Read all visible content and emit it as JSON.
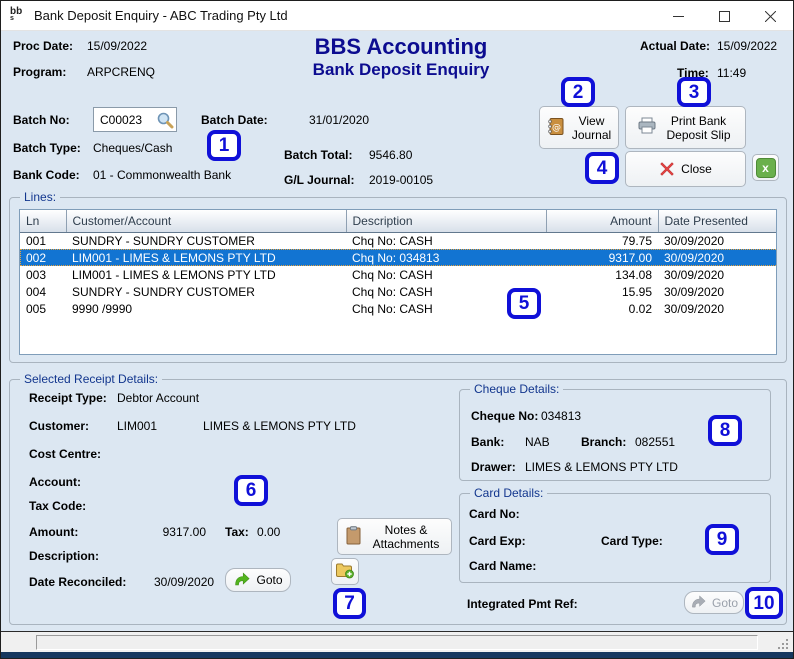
{
  "window": {
    "icon_text": "bb",
    "icon_sub": "s",
    "title": "Bank Deposit Enquiry - ABC Trading Pty Ltd"
  },
  "header": {
    "proc_date_label": "Proc Date:",
    "proc_date": "15/09/2022",
    "program_label": "Program:",
    "program": "ARPCRENQ",
    "app_title": "BBS Accounting",
    "screen_title": "Bank Deposit Enquiry",
    "actual_date_label": "Actual Date:",
    "actual_date": "15/09/2022",
    "time_label": "Time:",
    "time": "11:49"
  },
  "batch": {
    "batch_no_label": "Batch No:",
    "batch_no": "C00023",
    "batch_date_label": "Batch Date:",
    "batch_date": "31/01/2020",
    "batch_type_label": "Batch Type:",
    "batch_type": "Cheques/Cash",
    "batch_total_label": "Batch Total:",
    "batch_total": "9546.80",
    "bank_code_label": "Bank Code:",
    "bank_code": "01 - Commonwealth Bank",
    "gl_journal_label": "G/L Journal:",
    "gl_journal": "2019-00105"
  },
  "actions": {
    "view_journal": "View Journal",
    "print_deposit_slip": "Print Bank Deposit Slip",
    "close": "Close"
  },
  "lines": {
    "label": "Lines:",
    "columns": [
      "Ln",
      "Customer/Account",
      "Description",
      "Amount",
      "Date Presented"
    ],
    "rows": [
      {
        "ln": "001",
        "customer": "SUNDRY - SUNDRY CUSTOMER",
        "description": "Chq No: CASH",
        "amount": "79.75",
        "date_presented": "30/09/2020",
        "selected": false
      },
      {
        "ln": "002",
        "customer": "LIM001 - LIMES & LEMONS PTY LTD",
        "description": "Chq No: 034813",
        "amount": "9317.00",
        "date_presented": "30/09/2020",
        "selected": true
      },
      {
        "ln": "003",
        "customer": "LIM001 - LIMES & LEMONS PTY LTD",
        "description": "Chq No: CASH",
        "amount": "134.08",
        "date_presented": "30/09/2020",
        "selected": false
      },
      {
        "ln": "004",
        "customer": "SUNDRY - SUNDRY CUSTOMER",
        "description": "Chq No: CASH",
        "amount": "15.95",
        "date_presented": "30/09/2020",
        "selected": false
      },
      {
        "ln": "005",
        "customer": "9990 /9990",
        "description": "Chq No: CASH",
        "amount": "0.02",
        "date_presented": "30/09/2020",
        "selected": false
      }
    ]
  },
  "receipt": {
    "label": "Selected Receipt Details:",
    "receipt_type_label": "Receipt Type:",
    "receipt_type": "Debtor Account",
    "customer_label": "Customer:",
    "customer_code": "LIM001",
    "customer_name": "LIMES & LEMONS PTY LTD",
    "cost_centre_label": "Cost Centre:",
    "cost_centre": "",
    "account_label": "Account:",
    "account": "",
    "tax_code_label": "Tax Code:",
    "tax_code": "",
    "amount_label": "Amount:",
    "amount": "9317.00",
    "tax_label": "Tax:",
    "tax": "0.00",
    "description_label": "Description:",
    "description": "",
    "date_reconciled_label": "Date Reconciled:",
    "date_reconciled": "30/09/2020",
    "goto_label": "Goto",
    "notes_button": "Notes & Attachments"
  },
  "cheque": {
    "label": "Cheque Details:",
    "cheque_no_label": "Cheque No:",
    "cheque_no": "034813",
    "bank_label": "Bank:",
    "bank": "NAB",
    "branch_label": "Branch:",
    "branch": "082551",
    "drawer_label": "Drawer:",
    "drawer": "LIMES & LEMONS PTY LTD"
  },
  "card": {
    "label": "Card Details:",
    "card_no_label": "Card No:",
    "card_no": "",
    "card_exp_label": "Card Exp:",
    "card_exp": "",
    "card_type_label": "Card Type:",
    "card_type": "",
    "card_name_label": "Card Name:",
    "card_name": ""
  },
  "integrated": {
    "label": "Integrated Pmt Ref:",
    "value": "",
    "goto_label": "Goto"
  },
  "badges": [
    "1",
    "2",
    "3",
    "4",
    "5",
    "6",
    "7",
    "8",
    "9",
    "10"
  ],
  "colors": {
    "window_bg": "#dce7f2",
    "heading_navy": "#0c0c90",
    "group_label_navy": "#12368e",
    "badge_blue": "#1010d8",
    "selected_row_blue": "#1274d2",
    "close_x_red": "#e23c3c",
    "goto_green": "#52b41e",
    "excel_green": "#6ab04c",
    "taskbar_navy": "#15375e"
  }
}
